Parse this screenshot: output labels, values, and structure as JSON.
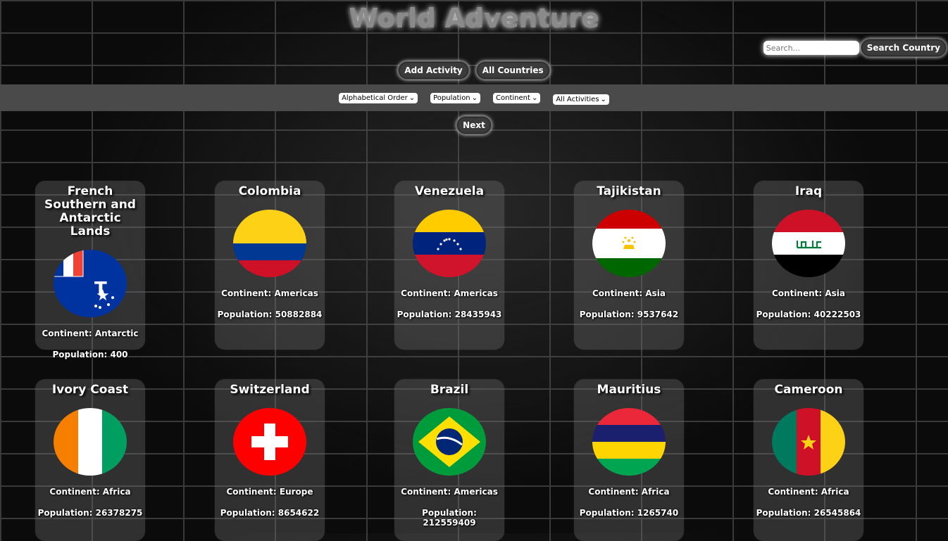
{
  "app": {
    "title": "World Adventure"
  },
  "search": {
    "placeholder": "Search...",
    "button_label": "Search Country"
  },
  "nav": {
    "add_activity": "Add Activity",
    "all_countries": "All Countries"
  },
  "filters": {
    "alphabetical": "Alphabetical Order",
    "population": "Population",
    "continent": "Continent",
    "activities": "All Activities"
  },
  "pagination": {
    "next": "Next"
  },
  "countries": [
    {
      "name": "French Southern and Antarctic Lands",
      "continent": "Continent: Antarctic",
      "population": "Population: 400",
      "flag": "fr-southern-flag-icon"
    },
    {
      "name": "Colombia",
      "continent": "Continent: Americas",
      "population": "Population: 50882884",
      "flag": "colombia-flag-icon"
    },
    {
      "name": "Venezuela",
      "continent": "Continent: Americas",
      "population": "Population: 28435943",
      "flag": "venezuela-flag-icon"
    },
    {
      "name": "Tajikistan",
      "continent": "Continent: Asia",
      "population": "Population: 9537642",
      "flag": "tajikistan-flag-icon"
    },
    {
      "name": "Iraq",
      "continent": "Continent: Asia",
      "population": "Population: 40222503",
      "flag": "iraq-flag-icon"
    },
    {
      "name": "Ivory Coast",
      "continent": "Continent: Africa",
      "population": "Population: 26378275",
      "flag": "ivory-coast-flag-icon"
    },
    {
      "name": "Switzerland",
      "continent": "Continent: Europe",
      "population": "Population: 8654622",
      "flag": "switzerland-flag-icon"
    },
    {
      "name": "Brazil",
      "continent": "Continent: Americas",
      "population": "Population: 212559409",
      "flag": "brazil-flag-icon"
    },
    {
      "name": "Mauritius",
      "continent": "Continent: Africa",
      "population": "Population: 1265740",
      "flag": "mauritius-flag-icon"
    },
    {
      "name": "Cameroon",
      "continent": "Continent: Africa",
      "population": "Population: 26545864",
      "flag": "cameroon-flag-icon"
    }
  ]
}
